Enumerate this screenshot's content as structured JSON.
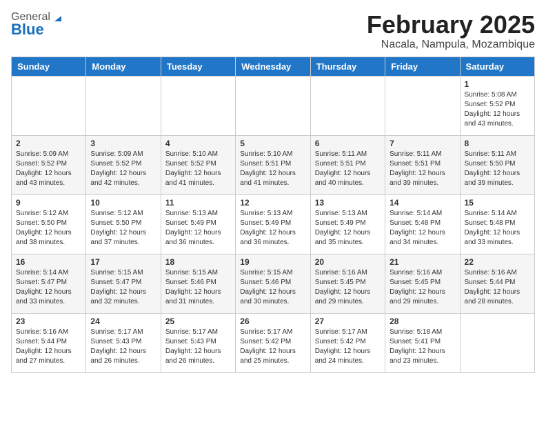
{
  "header": {
    "logo_general": "General",
    "logo_blue": "Blue",
    "month_title": "February 2025",
    "location": "Nacala, Nampula, Mozambique"
  },
  "days_of_week": [
    "Sunday",
    "Monday",
    "Tuesday",
    "Wednesday",
    "Thursday",
    "Friday",
    "Saturday"
  ],
  "weeks": [
    [
      {
        "day": "",
        "info": ""
      },
      {
        "day": "",
        "info": ""
      },
      {
        "day": "",
        "info": ""
      },
      {
        "day": "",
        "info": ""
      },
      {
        "day": "",
        "info": ""
      },
      {
        "day": "",
        "info": ""
      },
      {
        "day": "1",
        "info": "Sunrise: 5:08 AM\nSunset: 5:52 PM\nDaylight: 12 hours\nand 43 minutes."
      }
    ],
    [
      {
        "day": "2",
        "info": "Sunrise: 5:09 AM\nSunset: 5:52 PM\nDaylight: 12 hours\nand 43 minutes."
      },
      {
        "day": "3",
        "info": "Sunrise: 5:09 AM\nSunset: 5:52 PM\nDaylight: 12 hours\nand 42 minutes."
      },
      {
        "day": "4",
        "info": "Sunrise: 5:10 AM\nSunset: 5:52 PM\nDaylight: 12 hours\nand 41 minutes."
      },
      {
        "day": "5",
        "info": "Sunrise: 5:10 AM\nSunset: 5:51 PM\nDaylight: 12 hours\nand 41 minutes."
      },
      {
        "day": "6",
        "info": "Sunrise: 5:11 AM\nSunset: 5:51 PM\nDaylight: 12 hours\nand 40 minutes."
      },
      {
        "day": "7",
        "info": "Sunrise: 5:11 AM\nSunset: 5:51 PM\nDaylight: 12 hours\nand 39 minutes."
      },
      {
        "day": "8",
        "info": "Sunrise: 5:11 AM\nSunset: 5:50 PM\nDaylight: 12 hours\nand 39 minutes."
      }
    ],
    [
      {
        "day": "9",
        "info": "Sunrise: 5:12 AM\nSunset: 5:50 PM\nDaylight: 12 hours\nand 38 minutes."
      },
      {
        "day": "10",
        "info": "Sunrise: 5:12 AM\nSunset: 5:50 PM\nDaylight: 12 hours\nand 37 minutes."
      },
      {
        "day": "11",
        "info": "Sunrise: 5:13 AM\nSunset: 5:49 PM\nDaylight: 12 hours\nand 36 minutes."
      },
      {
        "day": "12",
        "info": "Sunrise: 5:13 AM\nSunset: 5:49 PM\nDaylight: 12 hours\nand 36 minutes."
      },
      {
        "day": "13",
        "info": "Sunrise: 5:13 AM\nSunset: 5:49 PM\nDaylight: 12 hours\nand 35 minutes."
      },
      {
        "day": "14",
        "info": "Sunrise: 5:14 AM\nSunset: 5:48 PM\nDaylight: 12 hours\nand 34 minutes."
      },
      {
        "day": "15",
        "info": "Sunrise: 5:14 AM\nSunset: 5:48 PM\nDaylight: 12 hours\nand 33 minutes."
      }
    ],
    [
      {
        "day": "16",
        "info": "Sunrise: 5:14 AM\nSunset: 5:47 PM\nDaylight: 12 hours\nand 33 minutes."
      },
      {
        "day": "17",
        "info": "Sunrise: 5:15 AM\nSunset: 5:47 PM\nDaylight: 12 hours\nand 32 minutes."
      },
      {
        "day": "18",
        "info": "Sunrise: 5:15 AM\nSunset: 5:46 PM\nDaylight: 12 hours\nand 31 minutes."
      },
      {
        "day": "19",
        "info": "Sunrise: 5:15 AM\nSunset: 5:46 PM\nDaylight: 12 hours\nand 30 minutes."
      },
      {
        "day": "20",
        "info": "Sunrise: 5:16 AM\nSunset: 5:45 PM\nDaylight: 12 hours\nand 29 minutes."
      },
      {
        "day": "21",
        "info": "Sunrise: 5:16 AM\nSunset: 5:45 PM\nDaylight: 12 hours\nand 29 minutes."
      },
      {
        "day": "22",
        "info": "Sunrise: 5:16 AM\nSunset: 5:44 PM\nDaylight: 12 hours\nand 28 minutes."
      }
    ],
    [
      {
        "day": "23",
        "info": "Sunrise: 5:16 AM\nSunset: 5:44 PM\nDaylight: 12 hours\nand 27 minutes."
      },
      {
        "day": "24",
        "info": "Sunrise: 5:17 AM\nSunset: 5:43 PM\nDaylight: 12 hours\nand 26 minutes."
      },
      {
        "day": "25",
        "info": "Sunrise: 5:17 AM\nSunset: 5:43 PM\nDaylight: 12 hours\nand 26 minutes."
      },
      {
        "day": "26",
        "info": "Sunrise: 5:17 AM\nSunset: 5:42 PM\nDaylight: 12 hours\nand 25 minutes."
      },
      {
        "day": "27",
        "info": "Sunrise: 5:17 AM\nSunset: 5:42 PM\nDaylight: 12 hours\nand 24 minutes."
      },
      {
        "day": "28",
        "info": "Sunrise: 5:18 AM\nSunset: 5:41 PM\nDaylight: 12 hours\nand 23 minutes."
      },
      {
        "day": "",
        "info": ""
      }
    ]
  ]
}
